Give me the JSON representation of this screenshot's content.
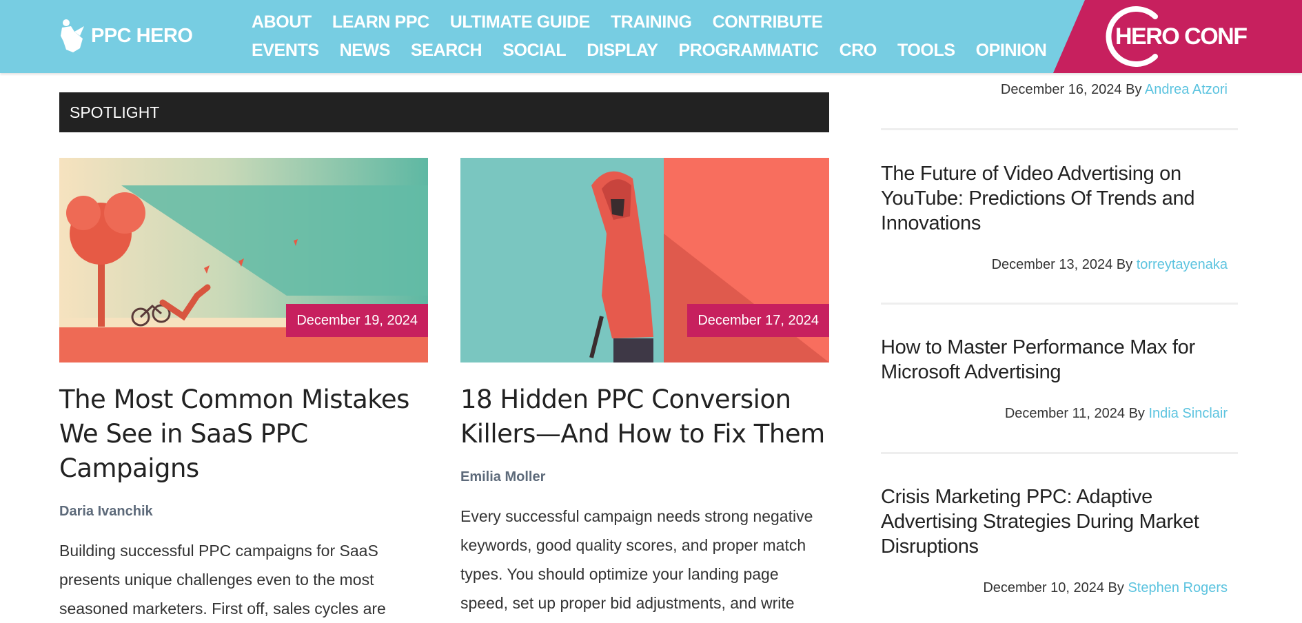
{
  "header": {
    "logo_text": "PPC HERO",
    "nav_row1": [
      "ABOUT",
      "LEARN PPC",
      "ULTIMATE GUIDE",
      "TRAINING",
      "CONTRIBUTE"
    ],
    "nav_row2": [
      "EVENTS",
      "NEWS",
      "SEARCH",
      "SOCIAL",
      "DISPLAY",
      "PROGRAMMATIC",
      "CRO",
      "TOOLS",
      "OPINION"
    ],
    "heroconf_text": "HERO CONF",
    "colors": {
      "header_bg": "#77cde2",
      "accent": "#c7205e"
    }
  },
  "spotlight": {
    "label": "SPOTLIGHT"
  },
  "cards": [
    {
      "date": "December 19, 2024",
      "title": "The Most Common Mistakes We See in SaaS PPC Campaigns",
      "author": "Daria Ivanchik",
      "excerpt": "Building successful PPC campaigns for SaaS presents unique challenges even to the most seasoned marketers. First off, sales cycles are"
    },
    {
      "date": "December 17, 2024",
      "title": "18 Hidden PPC Conversion Killers—And How to Fix Them",
      "author": "Emilia Moller",
      "excerpt": "Every successful campaign needs strong negative keywords, good quality scores, and proper match types. You should optimize your landing page speed, set up proper bid adjustments, and write"
    }
  ],
  "sidebar": {
    "by_label": "By",
    "top_meta": {
      "date": "December 16, 2024",
      "author": "Andrea Atzori"
    },
    "posts": [
      {
        "title": "The Future of Video Advertising on YouTube: Predictions Of Trends and Innovations",
        "date": "December 13, 2024",
        "author": "torreytayenaka"
      },
      {
        "title": "How to Master Performance Max for Microsoft Advertising",
        "date": "December 11, 2024",
        "author": "India Sinclair"
      },
      {
        "title": "Crisis Marketing PPC: Adaptive Advertising Strategies During Market Disruptions",
        "date": "December 10, 2024",
        "author": "Stephen Rogers"
      }
    ]
  }
}
